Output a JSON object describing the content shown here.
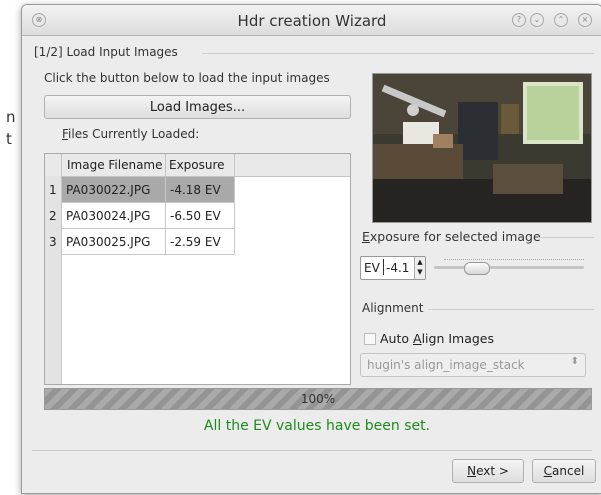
{
  "background_fragments": [
    "n",
    "t"
  ],
  "window": {
    "title": "Hdr creation Wizard",
    "title_buttons": [
      "help-icon",
      "collapse-icon",
      "maximize-icon",
      "close-icon"
    ]
  },
  "step": {
    "group_label": "[1/2] Load Input Images",
    "instruction": "Click the button below to load the input images",
    "load_button": "Load Images...",
    "files_label": "Files Currently Loaded:"
  },
  "table": {
    "headers": [
      "Image Filename",
      "Exposure"
    ],
    "rows": [
      {
        "num": "1",
        "filename": "PA030022.JPG",
        "exposure": "-4.18 EV",
        "selected": true
      },
      {
        "num": "2",
        "filename": "PA030024.JPG",
        "exposure": "-6.50 EV",
        "selected": false
      },
      {
        "num": "3",
        "filename": "PA030025.JPG",
        "exposure": "-2.59 EV",
        "selected": false
      }
    ]
  },
  "exposure_panel": {
    "label": "Exposure for selected image",
    "prefix": "EV",
    "value": "-4.1",
    "slider_fraction": 0.28
  },
  "alignment": {
    "label": "Alignment",
    "checkbox_label": "Auto Align Images",
    "checked": false,
    "method_value": "hugin's align_image_stack"
  },
  "progress": {
    "fraction": 1.0,
    "text": "100%"
  },
  "status_message": "All the EV values have been set.",
  "buttons": {
    "next": "Next >",
    "cancel": "Cancel"
  },
  "colors": {
    "status_green": "#1f8a1f",
    "selected_row": "#a9a9a9"
  }
}
